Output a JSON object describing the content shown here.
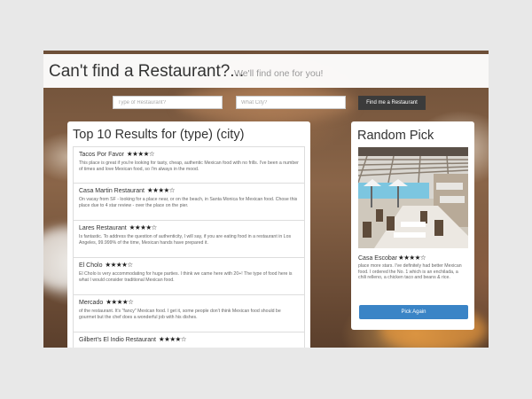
{
  "header": {
    "title": "Can't find a Restaurant?...",
    "subtitle": "We'll find one for you!"
  },
  "search": {
    "type_placeholder": "Type of Restaurant?",
    "city_placeholder": "What City?",
    "button_label": "Find me a Restaurant"
  },
  "results": {
    "title": "Top 10 Results for (type) (city)",
    "items": [
      {
        "name": "Tacos Por Favor",
        "stars": "★★★★☆",
        "desc": "This place is great if you're looking for tasty, cheap, authentic Mexican food with no frills. I've been a number of times and love Mexican food, so I'm always in the mood."
      },
      {
        "name": "Casa Martin Restaurant",
        "stars": "★★★★☆",
        "desc": "On vacay from SF - looking for a place near, or on the beach, in Santa Monica for Mexican food. Chose this place due to 4 star review - over the place on the pier."
      },
      {
        "name": "Lares Restaurant",
        "stars": "★★★★☆",
        "desc": "Is fantastic. To address the question of authenticity, I will say, if you are eating food in a restaurant in Los Angeles, 99.999% of the time, Mexican hands have prepared it."
      },
      {
        "name": "El Cholo",
        "stars": "★★★★☆",
        "desc": "El Cholo is very accommodating for huge parties. I think we came here with 20+! The type of food here is what I would consider traditional Mexican food."
      },
      {
        "name": "Mercado",
        "stars": "★★★★☆",
        "desc": "of the restaurant. It's \"fancy\" Mexican food. I get it, some people don't think Mexican food should be gourmet but the chef does a wonderful job with his dishes."
      },
      {
        "name": "Gilbert's El Indio Restaurant",
        "stars": "★★★★☆",
        "desc": ""
      }
    ]
  },
  "random_pick": {
    "title": "Random Pick",
    "name": "Casa Escobar",
    "stars": "★★★★☆",
    "desc": "place more stars. I've definitely had better Mexican food. I ordered the No. 1 which is an enchilada, a chili relleno, a chicken taco and beans & rice.",
    "button_label": "Pick Again"
  },
  "colors": {
    "accent_button": "#3a84c6",
    "dark_button": "#3b3b3b",
    "page_bg": "#e8e8e8"
  }
}
